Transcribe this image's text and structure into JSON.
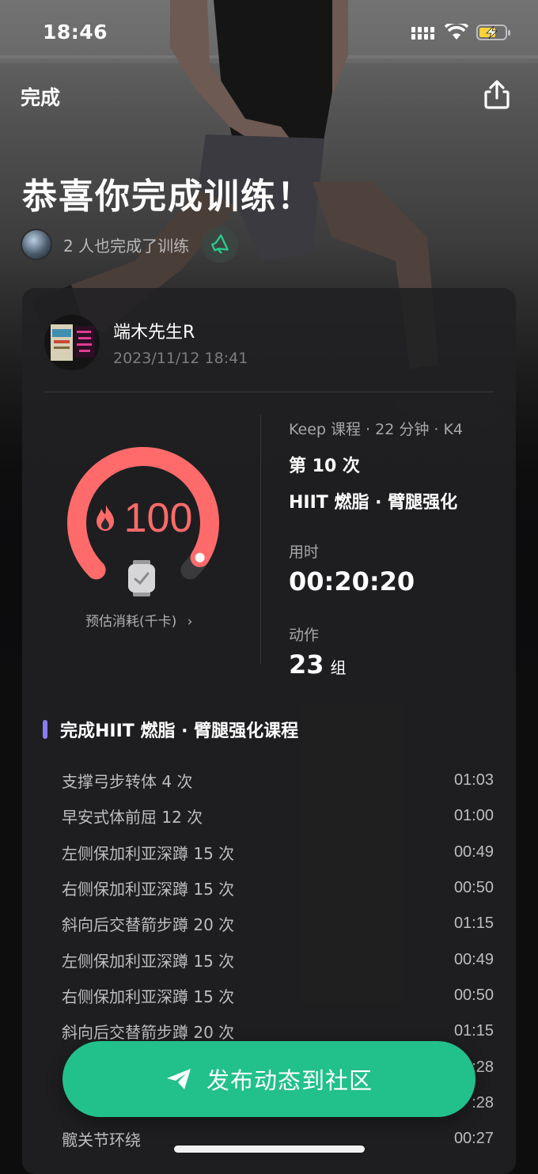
{
  "status_bar": {
    "time": "18:46",
    "icons": [
      "signal-icon",
      "wifi-icon",
      "battery-charging-icon"
    ]
  },
  "nav": {
    "done_label": "完成",
    "share_icon": "share-icon"
  },
  "hero": {
    "title": "恭喜你完成训练！",
    "others_completed": "2 人也完成了训练",
    "megaphone_icon": "megaphone-icon"
  },
  "card": {
    "user": {
      "name": "端木先生R",
      "timestamp": "2023/11/12 18:41"
    },
    "calories": {
      "value": "100",
      "label": "预估消耗(千卡)",
      "chevron": "›",
      "fill": 0.95,
      "colors": {
        "arc": "#ff6b6b",
        "track": "#3a3a3c",
        "text": "#ff6b6b"
      }
    },
    "course": {
      "meta": "Keep 课程 · 22 分钟 · K4",
      "session": "第 10 次",
      "name": "HIIT 燃脂 · 臂腿强化"
    },
    "duration": {
      "label": "用时",
      "value": "00:20:20"
    },
    "actions": {
      "label": "动作",
      "value": "23",
      "unit": "组"
    },
    "exercise_section": {
      "title": "完成HIIT 燃脂 · 臂腿强化课程",
      "accent": "#8b7bf0",
      "items": [
        {
          "name": "支撑弓步转体 4 次",
          "time": "01:03"
        },
        {
          "name": "早安式体前屈 12 次",
          "time": "01:00"
        },
        {
          "name": "左侧保加利亚深蹲 15 次",
          "time": "00:49"
        },
        {
          "name": "右侧保加利亚深蹲 15 次",
          "time": "00:50"
        },
        {
          "name": "斜向后交替箭步蹲 20 次",
          "time": "01:15"
        },
        {
          "name": "左侧保加利亚深蹲 15 次",
          "time": "00:49"
        },
        {
          "name": "右侧保加利亚深蹲 15 次",
          "time": "00:50"
        },
        {
          "name": "斜向后交替箭步蹲 20 次",
          "time": "01:15"
        },
        {
          "name": "",
          "time": ":28"
        },
        {
          "name": "",
          "time": ":28"
        },
        {
          "name": "髋关节环绕",
          "time": "00:27"
        }
      ]
    }
  },
  "publish_button": {
    "label": "发布动态到社区",
    "icon": "send-icon",
    "color": "#22c08a"
  }
}
